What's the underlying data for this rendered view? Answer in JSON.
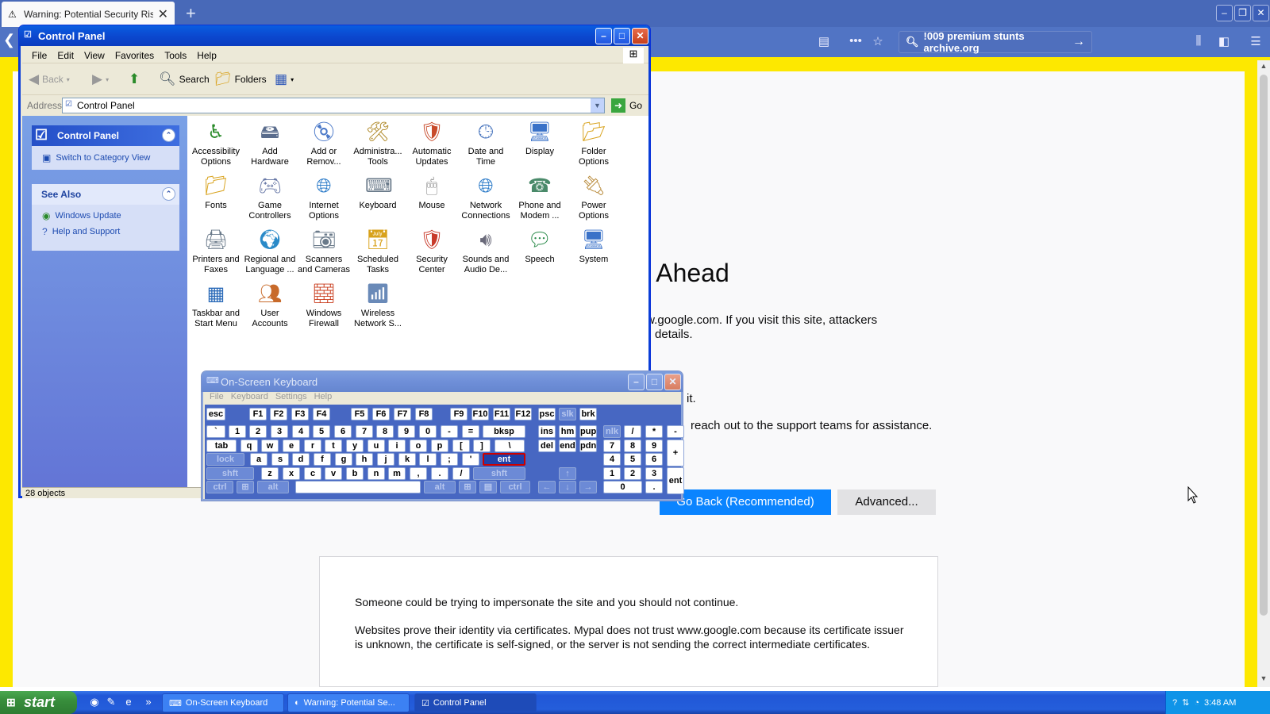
{
  "browser": {
    "tab_title": "Warning: Potential Security Risk A",
    "url_text": "!009 premium stunts archive.org",
    "error_title": "isk Ahead",
    "error_line1": "o www.google.com. If you visit this site, attackers",
    "error_line2": "it card details.",
    "error_line3": "lo to resolve it.",
    "error_line4": "reach out to the support teams for assistance.",
    "go_back_label": "Go Back (Recommended)",
    "advanced_label": "Advanced...",
    "adv_para1": "Someone could be trying to impersonate the site and you should not continue.",
    "adv_para2": "Websites prove their identity via certificates. Mypal does not trust www.google.com because its certificate issuer is unknown, the certificate is self-signed, or the server is not sending the correct intermediate certificates."
  },
  "control_panel": {
    "title": "Control Panel",
    "menu": [
      "File",
      "Edit",
      "View",
      "Favorites",
      "Tools",
      "Help"
    ],
    "toolbar": {
      "back": "Back",
      "search": "Search",
      "folders": "Folders"
    },
    "address_label": "Address",
    "address_value": "Control Panel",
    "go_label": "Go",
    "left_panel": {
      "section1_title": "Control Panel",
      "switch_view": "Switch to Category View",
      "see_also_title": "See Also",
      "see_also_items": [
        "Windows Update",
        "Help and Support"
      ]
    },
    "items": [
      [
        "Accessibility",
        "Options"
      ],
      [
        "Add",
        "Hardware"
      ],
      [
        "Add or",
        "Remov..."
      ],
      [
        "Administra...",
        "Tools"
      ],
      [
        "Automatic",
        "Updates"
      ],
      [
        "Date and",
        "Time"
      ],
      [
        "Display",
        ""
      ],
      [
        "Folder",
        "Options"
      ],
      [
        "Fonts",
        ""
      ],
      [
        "Game",
        "Controllers"
      ],
      [
        "Internet",
        "Options"
      ],
      [
        "Keyboard",
        ""
      ],
      [
        "Mouse",
        ""
      ],
      [
        "Network",
        "Connections"
      ],
      [
        "Phone and",
        "Modem ..."
      ],
      [
        "Power",
        "Options"
      ],
      [
        "Printers and",
        "Faxes"
      ],
      [
        "Regional and",
        "Language ..."
      ],
      [
        "Scanners",
        "and Cameras"
      ],
      [
        "Scheduled",
        "Tasks"
      ],
      [
        "Security",
        "Center"
      ],
      [
        "Sounds and",
        "Audio De..."
      ],
      [
        "Speech",
        ""
      ],
      [
        "System",
        ""
      ],
      [
        "Taskbar and",
        "Start Menu"
      ],
      [
        "User",
        "Accounts"
      ],
      [
        "Windows",
        "Firewall"
      ],
      [
        "Wireless",
        "Network S..."
      ]
    ],
    "status": "28 objects"
  },
  "osk": {
    "title": "On-Screen Keyboard",
    "menu": [
      "File",
      "Keyboard",
      "Settings",
      "Help"
    ]
  },
  "taskbar": {
    "start": "start",
    "tasks": [
      "On-Screen Keyboard",
      "Warning: Potential Se...",
      "Control Panel"
    ],
    "clock": "3:48 AM"
  }
}
